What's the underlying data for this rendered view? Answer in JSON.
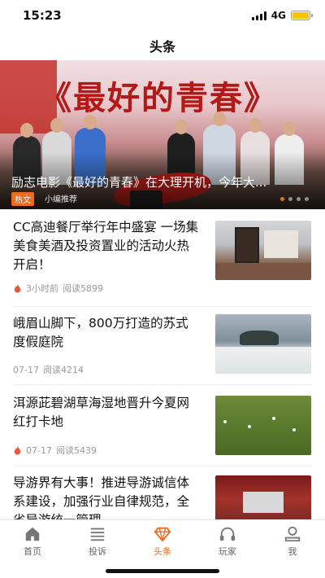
{
  "status_bar": {
    "time": "15:23",
    "network": "4G",
    "battery_color": "#f5c400"
  },
  "header": {
    "title": "头条"
  },
  "banner": {
    "calligraphy": "《最好的青春》",
    "caption": "励志电影《最好的青春》在大理开机，今年大...",
    "tag": "热文",
    "source": "小编推荐",
    "dot_count": 4,
    "active_dot": 0
  },
  "news": [
    {
      "title": "CC高迪餐厅举行年中盛宴 一场集美食美酒及投资置业的活动火热开启！",
      "time": "3小时前",
      "reads": "阅读5899",
      "hot": true
    },
    {
      "title": "峨眉山脚下，800万打造的苏式度假庭院",
      "time": "07-17",
      "reads": "阅读4214",
      "hot": false
    },
    {
      "title": "洱源茈碧湖草海湿地晋升今夏网红打卡地",
      "time": "07-17",
      "reads": "阅读5439",
      "hot": true
    },
    {
      "title": "导游界有大事！推进导游诚信体系建设，加强行业自律规范，全省导游统一管理",
      "time": "",
      "reads": "",
      "hot": false
    }
  ],
  "tabbar": {
    "items": [
      {
        "label": "首页",
        "icon": "home-icon",
        "active": false
      },
      {
        "label": "投诉",
        "icon": "list-icon",
        "active": false
      },
      {
        "label": "头条",
        "icon": "diamond-icon",
        "active": true
      },
      {
        "label": "玩家",
        "icon": "headphones-icon",
        "active": false
      },
      {
        "label": "我",
        "icon": "person-icon",
        "active": false
      }
    ],
    "accent_color": "#f06a1c"
  }
}
